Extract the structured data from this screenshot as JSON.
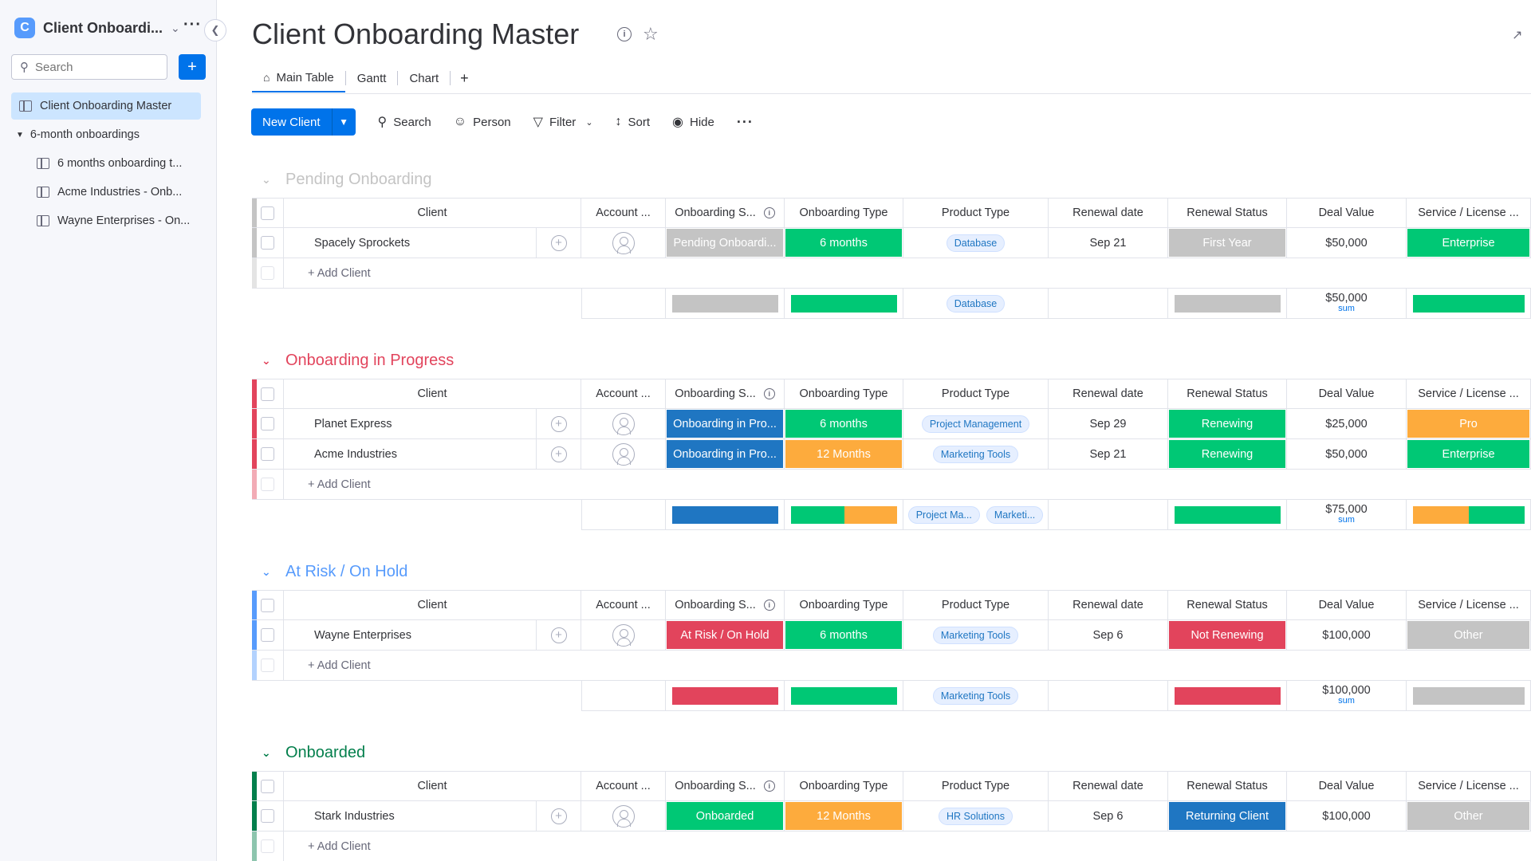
{
  "workspace": {
    "initial": "C",
    "name": "Client Onboardi...",
    "more": "…"
  },
  "sidebar": {
    "search_placeholder": "Search",
    "add_label": "+",
    "items": [
      {
        "label": "Client Onboarding Master"
      },
      {
        "label": "6-month onboardings"
      },
      {
        "label": "6 months onboarding t..."
      },
      {
        "label": "Acme Industries - Onb..."
      },
      {
        "label": "Wayne Enterprises - On..."
      }
    ]
  },
  "board": {
    "title": "Client Onboarding Master",
    "tabs": [
      {
        "label": "Main Table"
      },
      {
        "label": "Gantt"
      },
      {
        "label": "Chart"
      }
    ],
    "add_tab": "+"
  },
  "toolbar": {
    "new_label": "New Client",
    "search": "Search",
    "person": "Person",
    "filter": "Filter",
    "sort": "Sort",
    "hide": "Hide"
  },
  "columns": {
    "client": "Client",
    "account": "Account ...",
    "onb_status": "Onboarding S...",
    "onb_type": "Onboarding Type",
    "product": "Product Type",
    "renewal_date": "Renewal date",
    "renewal_status": "Renewal Status",
    "deal_value": "Deal Value",
    "service": "Service / License ..."
  },
  "add_client": "+ Add Client",
  "sum_label": "sum",
  "colors": {
    "grey": "#c4c4c4",
    "green": "#00c875",
    "orange": "#fdab3d",
    "blue": "#0073ea",
    "dark_blue": "#1f76c2",
    "red": "#e2445c",
    "pink": "#e2445c",
    "purple_blue": "#579bfc",
    "dark_green": "#037f4c"
  },
  "groups": [
    {
      "title": "Pending Onboarding",
      "color": "#c4c4c4",
      "rows": [
        {
          "client": "Spacely Sprockets",
          "onb_status": "Pending Onboardi...",
          "onb_status_color": "#c4c4c4",
          "onb_type": "6 months",
          "onb_type_color": "#00c875",
          "product": "Database",
          "renewal_date": "Sep 21",
          "renewal_status": "First Year",
          "renewal_status_color": "#c4c4c4",
          "deal_value": "$50,000",
          "service": "Enterprise",
          "service_color": "#00c875"
        }
      ],
      "summary": {
        "deal_value": "$50,000",
        "products": [
          "Database"
        ]
      }
    },
    {
      "title": "Onboarding in Progress",
      "color": "#e2445c",
      "rows": [
        {
          "client": "Planet Express",
          "onb_status": "Onboarding in Pro...",
          "onb_status_color": "#1f76c2",
          "onb_type": "6 months",
          "onb_type_color": "#00c875",
          "product": "Project Management",
          "renewal_date": "Sep 29",
          "renewal_status": "Renewing",
          "renewal_status_color": "#00c875",
          "deal_value": "$25,000",
          "service": "Pro",
          "service_color": "#fdab3d"
        },
        {
          "client": "Acme Industries",
          "onb_status": "Onboarding in Pro...",
          "onb_status_color": "#1f76c2",
          "onb_type": "12 Months",
          "onb_type_color": "#fdab3d",
          "product": "Marketing Tools",
          "renewal_date": "Sep 21",
          "renewal_status": "Renewing",
          "renewal_status_color": "#00c875",
          "deal_value": "$50,000",
          "service": "Enterprise",
          "service_color": "#00c875"
        }
      ],
      "summary": {
        "deal_value": "$75,000",
        "products": [
          "Project Ma...",
          "Marketi..."
        ]
      }
    },
    {
      "title": "At Risk / On Hold",
      "color": "#579bfc",
      "rows": [
        {
          "client": "Wayne Enterprises",
          "onb_status": "At Risk / On Hold",
          "onb_status_color": "#e2445c",
          "onb_type": "6 months",
          "onb_type_color": "#00c875",
          "product": "Marketing Tools",
          "renewal_date": "Sep 6",
          "renewal_status": "Not Renewing",
          "renewal_status_color": "#e2445c",
          "deal_value": "$100,000",
          "service": "Other",
          "service_color": "#c4c4c4"
        }
      ],
      "summary": {
        "deal_value": "$100,000",
        "products": [
          "Marketing Tools"
        ]
      }
    },
    {
      "title": "Onboarded",
      "color": "#037f4c",
      "rows": [
        {
          "client": "Stark Industries",
          "onb_status": "Onboarded",
          "onb_status_color": "#00c875",
          "onb_type": "12 Months",
          "onb_type_color": "#fdab3d",
          "product": "HR Solutions",
          "renewal_date": "Sep 6",
          "renewal_status": "Returning Client",
          "renewal_status_color": "#1f76c2",
          "deal_value": "$100,000",
          "service": "Other",
          "service_color": "#c4c4c4"
        }
      ],
      "summary": null
    }
  ]
}
